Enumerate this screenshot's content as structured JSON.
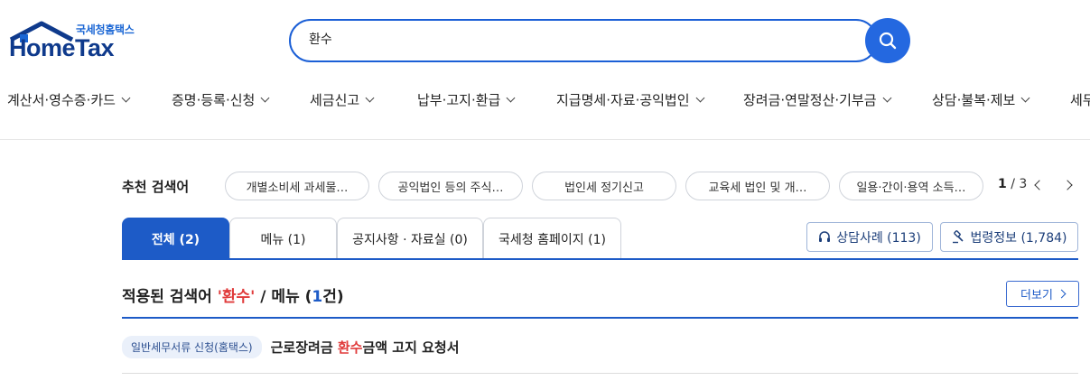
{
  "logo": {
    "kr": "국세청홈택스",
    "en": "HomeTax"
  },
  "search": {
    "value": "환수",
    "placeholder": ""
  },
  "nav": [
    {
      "label": "계산서·영수증·카드"
    },
    {
      "label": "증명·등록·신청"
    },
    {
      "label": "세금신고"
    },
    {
      "label": "납부·고지·환급"
    },
    {
      "label": "지급명세·자료·공익법인"
    },
    {
      "label": "장려금·연말정산·기부금"
    },
    {
      "label": "상담·불복·제보"
    },
    {
      "label": "세무"
    }
  ],
  "recommended": {
    "label": "추천 검색어",
    "chips": [
      "개별소비세 과세물…",
      "공익법인 등의 주식…",
      "법인세 정기신고",
      "교육세 법인 및 개…",
      "일용·간이·용역 소득…"
    ],
    "page_current": "1",
    "page_total": "/ 3"
  },
  "tabs": [
    {
      "label": "전체 (2)"
    },
    {
      "label": "메뉴 (1)"
    },
    {
      "label": "공지사항 · 자료실 (0)"
    },
    {
      "label": "국세청 홈페이지 (1)"
    }
  ],
  "side_buttons": {
    "consult": "상담사례 (113)",
    "law": "법령정보 (1,784)"
  },
  "result": {
    "prefix": "적용된 검색어 ",
    "keyword": "'환수'",
    "middle": " / 메뉴 (",
    "count": "1",
    "suffix": "건)",
    "more": "더보기"
  },
  "result_item": {
    "badge": "일반세무서류 신청(홈택스)",
    "title_pre": "근로장려금 ",
    "title_hl": "환수",
    "title_post": "금액 고지 요청서"
  },
  "colors": {
    "accent": "#1d5bc7",
    "highlight": "#e03a3a",
    "search_button": "#2468e0"
  }
}
